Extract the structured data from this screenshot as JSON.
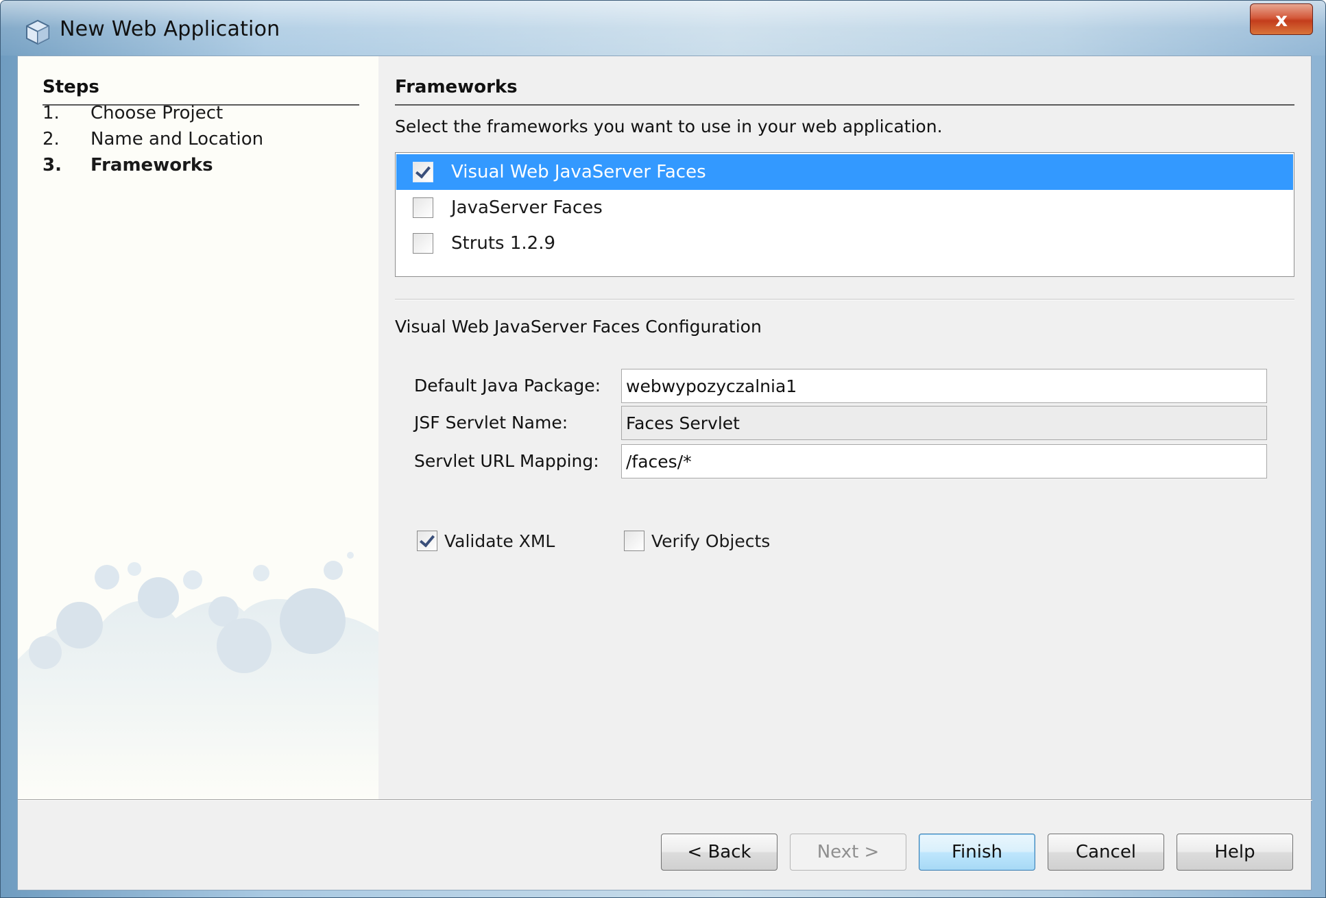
{
  "window": {
    "title": "New Web Application",
    "close_label": "x"
  },
  "steps": {
    "title": "Steps",
    "items": [
      {
        "num": "1.",
        "label": "Choose Project",
        "active": false
      },
      {
        "num": "2.",
        "label": "Name and Location",
        "active": false
      },
      {
        "num": "3.",
        "label": "Frameworks",
        "active": true
      }
    ]
  },
  "frameworks": {
    "title": "Frameworks",
    "instructions": "Select the frameworks you want to use in your web application.",
    "items": [
      {
        "label": "Visual Web JavaServer Faces",
        "checked": true,
        "selected": true
      },
      {
        "label": "JavaServer Faces",
        "checked": false,
        "selected": false
      },
      {
        "label": "Struts 1.2.9",
        "checked": false,
        "selected": false
      }
    ]
  },
  "config": {
    "title": "Visual Web JavaServer Faces Configuration",
    "package_label": "Default Java Package:",
    "package_value": "webwypozyczalnia1",
    "servlet_name_label": "JSF Servlet Name:",
    "servlet_name_value": "Faces Servlet",
    "url_mapping_label": "Servlet URL Mapping:",
    "url_mapping_value": "/faces/*",
    "validate_xml_label": "Validate XML",
    "validate_xml_checked": true,
    "verify_objects_label": "Verify Objects",
    "verify_objects_checked": false
  },
  "buttons": {
    "back": "< Back",
    "next": "Next >",
    "finish": "Finish",
    "cancel": "Cancel",
    "help": "Help"
  },
  "colors": {
    "selection": "#3399ff",
    "panel": "#f0f0f0",
    "steps_bg": "#fdfdf8"
  }
}
